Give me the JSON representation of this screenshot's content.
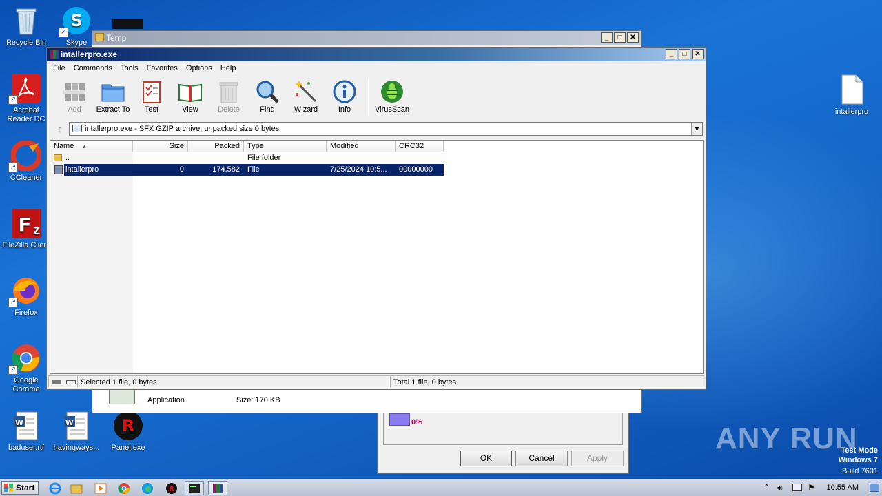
{
  "desktop": {
    "icons": [
      {
        "label": "Recycle Bin"
      },
      {
        "label": "Skype"
      },
      {
        "label": "Acrobat Reader DC"
      },
      {
        "label": "CCleaner"
      },
      {
        "label": "FileZilla Client"
      },
      {
        "label": "Firefox"
      },
      {
        "label": "Google Chrome"
      },
      {
        "label": "baduser.rtf"
      },
      {
        "label": "havingways..."
      },
      {
        "label": "Panel.exe"
      },
      {
        "label": "intallerpro"
      }
    ]
  },
  "back_window": {
    "title": "Temp",
    "file_type": "Application",
    "file_size": "Size: 170 KB"
  },
  "props_dialog": {
    "percent": "0%",
    "ok": "OK",
    "cancel": "Cancel",
    "apply": "Apply"
  },
  "main_window": {
    "title": "intallerpro.exe",
    "menu": [
      "File",
      "Commands",
      "Tools",
      "Favorites",
      "Options",
      "Help"
    ],
    "toolbar": [
      {
        "label": "Add",
        "icon": "add-archive-icon"
      },
      {
        "label": "Extract To",
        "icon": "extract-folder-icon"
      },
      {
        "label": "Test",
        "icon": "test-checklist-icon"
      },
      {
        "label": "View",
        "icon": "view-book-icon"
      },
      {
        "label": "Delete",
        "icon": "trash-icon"
      },
      {
        "label": "Find",
        "icon": "magnifier-icon"
      },
      {
        "label": "Wizard",
        "icon": "wand-icon"
      },
      {
        "label": "Info",
        "icon": "info-icon"
      },
      {
        "label": "VirusScan",
        "icon": "bug-icon"
      }
    ],
    "path": "intallerpro.exe - SFX GZIP archive, unpacked size 0 bytes",
    "columns": [
      "Name",
      "Size",
      "Packed",
      "Type",
      "Modified",
      "CRC32"
    ],
    "rows": [
      {
        "name": "..",
        "size": "",
        "packed": "",
        "type": "File folder",
        "modified": "",
        "crc": ""
      },
      {
        "name": "intallerpro",
        "size": "0",
        "packed": "174,582",
        "type": "File",
        "modified": "7/25/2024 10:5...",
        "crc": "00000000"
      }
    ],
    "status_left": "Selected 1 file, 0 bytes",
    "status_right": "Total 1 file, 0 bytes"
  },
  "taskbar": {
    "start": "Start",
    "time": "10:55 AM"
  },
  "watermark": "ANY RUN",
  "test_mode": {
    "line1": "Test Mode",
    "line2": "Windows 7",
    "line3": "Build 7601"
  },
  "colors": {
    "title_active": "#0a246a",
    "selection": "#0a246a",
    "desktop": "#1466c8"
  }
}
